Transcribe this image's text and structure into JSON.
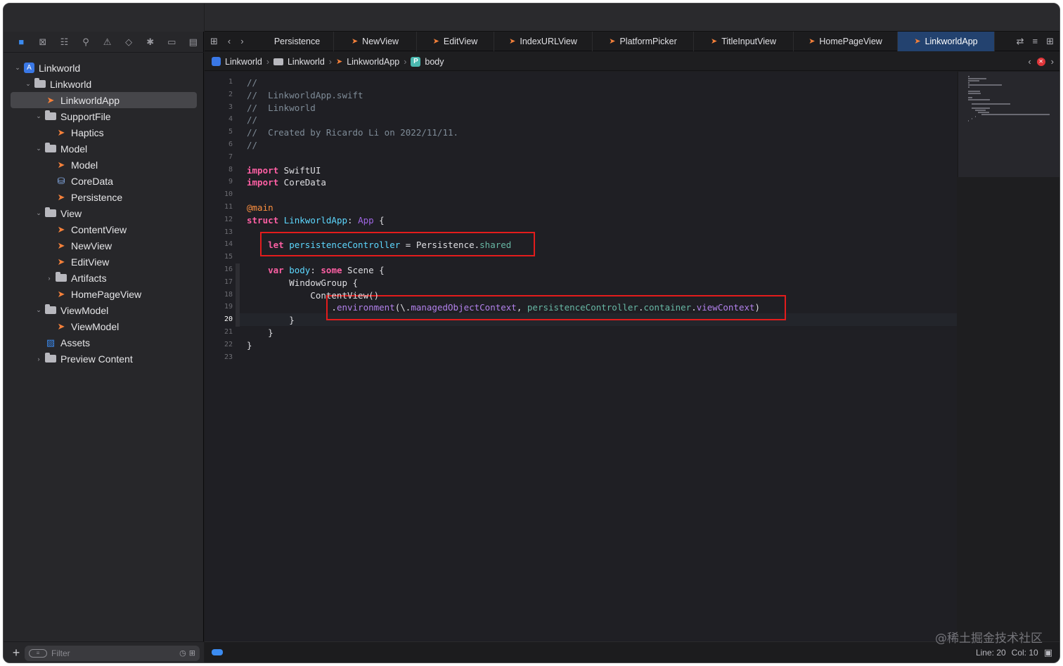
{
  "sidebar": {
    "nav_icons": [
      "folder-icon",
      "source-control-icon",
      "hierarchy-icon",
      "search-icon",
      "warning-icon",
      "test-icon",
      "debug-icon",
      "breakpoint-icon",
      "report-icon"
    ],
    "tree": [
      {
        "label": "Linkworld",
        "icon": "app-icon",
        "depth": 0,
        "chev": "open"
      },
      {
        "label": "Linkworld",
        "icon": "folder-icon",
        "depth": 1,
        "chev": "open"
      },
      {
        "label": "LinkworldApp",
        "icon": "swift-icon",
        "depth": 2,
        "chev": "none",
        "selected": true
      },
      {
        "label": "SupportFile",
        "icon": "folder-icon",
        "depth": 2,
        "chev": "open"
      },
      {
        "label": "Haptics",
        "icon": "swift-icon",
        "depth": 3,
        "chev": "none"
      },
      {
        "label": "Model",
        "icon": "folder-icon",
        "depth": 2,
        "chev": "open"
      },
      {
        "label": "Model",
        "icon": "swift-icon",
        "depth": 3,
        "chev": "none"
      },
      {
        "label": "CoreData",
        "icon": "coredata-icon",
        "depth": 3,
        "chev": "none"
      },
      {
        "label": "Persistence",
        "icon": "swift-icon",
        "depth": 3,
        "chev": "none"
      },
      {
        "label": "View",
        "icon": "folder-icon",
        "depth": 2,
        "chev": "open"
      },
      {
        "label": "ContentView",
        "icon": "swift-icon",
        "depth": 3,
        "chev": "none"
      },
      {
        "label": "NewView",
        "icon": "swift-icon",
        "depth": 3,
        "chev": "none"
      },
      {
        "label": "EditView",
        "icon": "swift-icon",
        "depth": 3,
        "chev": "none"
      },
      {
        "label": "Artifacts",
        "icon": "folder-icon",
        "depth": 3,
        "chev": "closed"
      },
      {
        "label": "HomePageView",
        "icon": "swift-icon",
        "depth": 3,
        "chev": "none"
      },
      {
        "label": "ViewModel",
        "icon": "folder-icon",
        "depth": 2,
        "chev": "open"
      },
      {
        "label": "ViewModel",
        "icon": "swift-icon",
        "depth": 3,
        "chev": "none"
      },
      {
        "label": "Assets",
        "icon": "assets-icon",
        "depth": 2,
        "chev": "none"
      },
      {
        "label": "Preview Content",
        "icon": "folder-icon",
        "depth": 2,
        "chev": "closed"
      }
    ],
    "filter_placeholder": "Filter"
  },
  "tabs": [
    {
      "label": "Persistence",
      "active": false
    },
    {
      "label": "NewView",
      "active": false
    },
    {
      "label": "EditView",
      "active": false
    },
    {
      "label": "IndexURLView",
      "active": false
    },
    {
      "label": "PlatformPicker",
      "active": false
    },
    {
      "label": "TitleInputView",
      "active": false
    },
    {
      "label": "HomePageView",
      "active": false
    },
    {
      "label": "LinkworldApp",
      "active": true
    }
  ],
  "breadcrumb": {
    "project": "Linkworld",
    "group": "Linkworld",
    "file": "LinkworldApp",
    "symbol_badge": "P",
    "symbol": "body"
  },
  "code_lines": [
    "//",
    "//  LinkworldApp.swift",
    "//  Linkworld",
    "//",
    "//  Created by Ricardo Li on 2022/11/11.",
    "//",
    "",
    "import SwiftUI",
    "import CoreData",
    "",
    "@main",
    "struct LinkworldApp: App {",
    "",
    "    let persistenceController = Persistence.shared",
    "",
    "    var body: some Scene {",
    "        WindowGroup {",
    "            ContentView()",
    "                .environment(\\.managedObjectContext, persistenceController.container.viewContext)",
    "        }",
    "    }",
    "}",
    ""
  ],
  "current_line": 20,
  "status": {
    "line_label": "Line: 20",
    "col_label": "Col: 10"
  },
  "watermark": "@稀土掘金技术社区"
}
